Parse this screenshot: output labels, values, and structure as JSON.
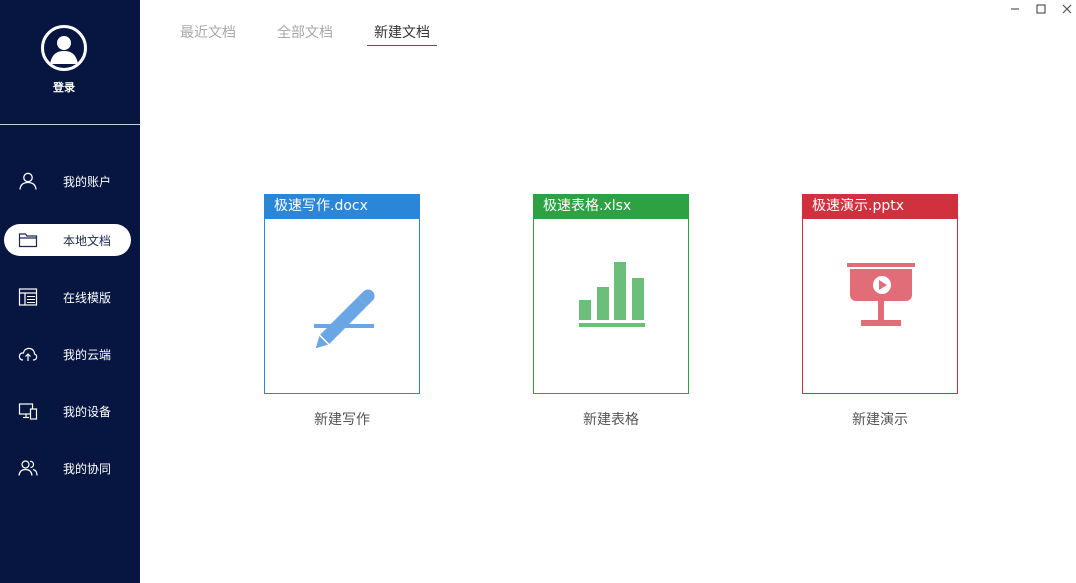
{
  "sidebar": {
    "login_label": "登录",
    "items": [
      {
        "label": "我的账户",
        "icon": "user-icon"
      },
      {
        "label": "本地文档",
        "icon": "folder-icon"
      },
      {
        "label": "在线模版",
        "icon": "template-icon"
      },
      {
        "label": "我的云端",
        "icon": "cloud-upload-icon"
      },
      {
        "label": "我的设备",
        "icon": "devices-icon"
      },
      {
        "label": "我的协同",
        "icon": "collaborate-icon"
      }
    ],
    "active_index": 1
  },
  "tabs": [
    {
      "label": "最近文档"
    },
    {
      "label": "全部文档"
    },
    {
      "label": "新建文档"
    }
  ],
  "active_tab": 2,
  "cards": [
    {
      "header": "极速写作.docx",
      "caption": "新建写作",
      "color": "#2b86d8",
      "icon": "pencil-icon"
    },
    {
      "header": "极速表格.xlsx",
      "caption": "新建表格",
      "color": "#2ea243",
      "icon": "bar-chart-icon"
    },
    {
      "header": "极速演示.pptx",
      "caption": "新建演示",
      "color": "#d1303f",
      "icon": "presentation-icon"
    }
  ],
  "colors": {
    "sidebar_bg": "#061640",
    "word_accent": "#2b86d8",
    "excel_accent": "#2ea243",
    "ppt_accent": "#d1303f"
  }
}
